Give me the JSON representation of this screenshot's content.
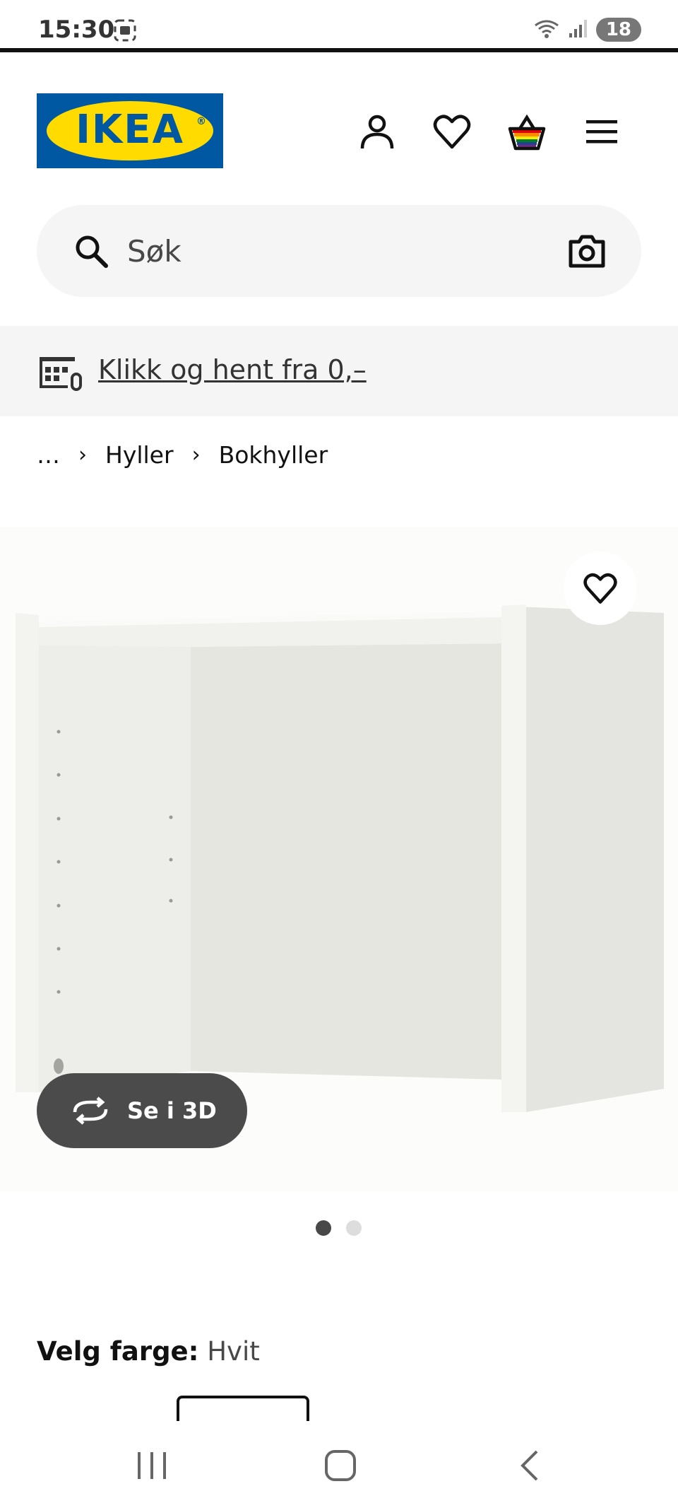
{
  "status_bar": {
    "time": "15:30",
    "battery": "18",
    "icons": [
      "screenshot-icon",
      "wifi-icon",
      "signal-icon"
    ]
  },
  "header": {
    "logo_text": "IKEA",
    "icons": [
      "account-icon",
      "favorites-icon",
      "cart-icon",
      "menu-icon"
    ]
  },
  "search": {
    "placeholder": "Søk",
    "icons": [
      "search-icon",
      "camera-icon"
    ]
  },
  "promo": {
    "text": "Klikk og hent fra 0,–",
    "icon": "store-pickup-icon"
  },
  "breadcrumb": {
    "items": [
      "…",
      "Hyller",
      "Bokhyller"
    ]
  },
  "product_image": {
    "view_3d_label": "Se i 3D",
    "carousel_total": 2,
    "carousel_active": 1
  },
  "color": {
    "label": "Velg farge:",
    "value": "Hvit"
  },
  "colors": {
    "ikea_blue": "#0058a3",
    "ikea_yellow": "#ffdb00",
    "text_dark": "#111111",
    "button_dark": "#4b4b4b"
  }
}
